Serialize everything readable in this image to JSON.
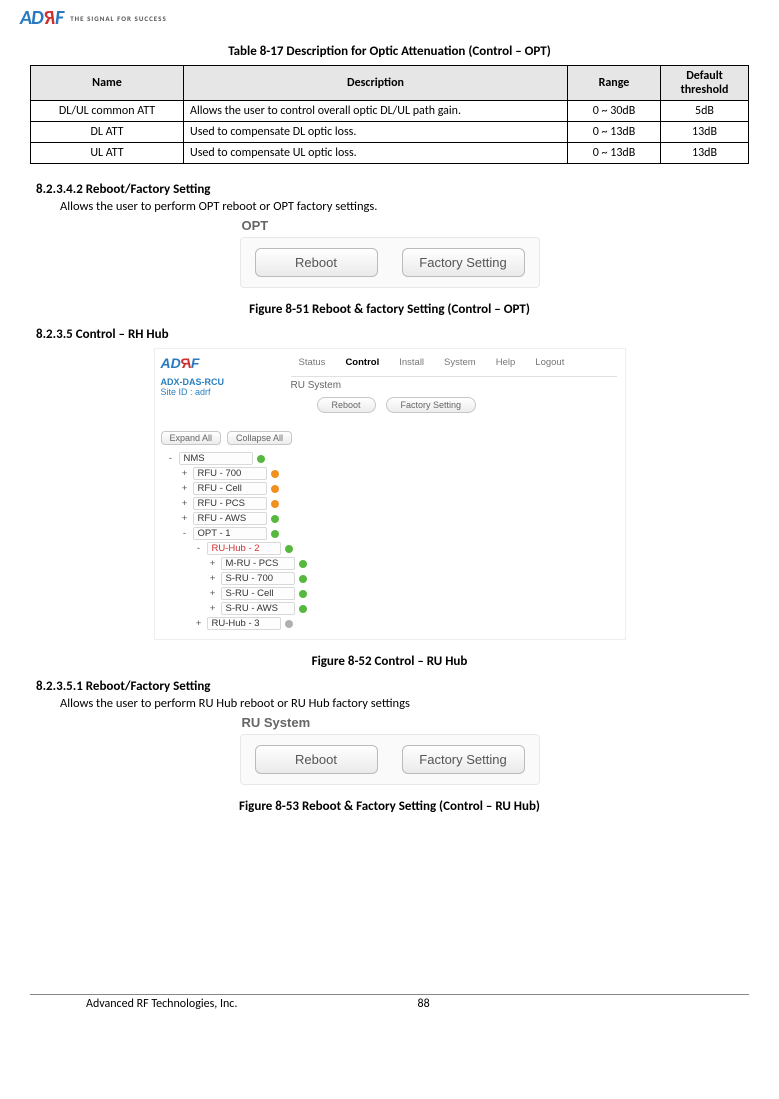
{
  "logo": {
    "tagline": "THE SIGNAL FOR SUCCESS"
  },
  "table817": {
    "caption": "Table 8-17    Description for Optic Attenuation (Control – OPT)",
    "headers": [
      "Name",
      "Description",
      "Range",
      "Default threshold"
    ],
    "rows": [
      [
        "DL/UL common ATT",
        "Allows the user to control overall optic DL/UL path gain.",
        "0 ~ 30dB",
        "5dB"
      ],
      [
        "DL ATT",
        "Used to compensate DL optic loss.",
        "0 ~ 13dB",
        "13dB"
      ],
      [
        "UL ATT",
        "Used to compensate UL optic loss.",
        "0 ~ 13dB",
        "13dB"
      ]
    ]
  },
  "sec823_4_2": {
    "num": "8.2.3.4.2    Reboot/Factory Setting",
    "body": "Allows the user to perform OPT reboot or OPT factory settings.",
    "panel_label": "OPT",
    "btn_reboot": "Reboot",
    "btn_factory": "Factory Setting"
  },
  "fig851": "Figure 8-51    Reboot & factory Setting (Control – OPT)",
  "sec8235": {
    "num": "8.2.3.5    Control – RH Hub"
  },
  "fig52ui": {
    "left": {
      "line1": "ADX-DAS-RCU",
      "line2": "Site ID : adrf"
    },
    "tabs": [
      "Status",
      "Control",
      "Install",
      "System",
      "Help",
      "Logout"
    ],
    "active_tab_index": 1,
    "ru_label": "RU System",
    "btn_reboot": "Reboot",
    "btn_factory": "Factory Setting",
    "expand": "Expand All",
    "collapse": "Collapse All",
    "tree": [
      {
        "toggle": "-",
        "label": "NMS",
        "dot": "green",
        "children": [
          {
            "toggle": "+",
            "label": "RFU - 700",
            "dot": "orange"
          },
          {
            "toggle": "+",
            "label": "RFU - Cell",
            "dot": "orange"
          },
          {
            "toggle": "+",
            "label": "RFU - PCS",
            "dot": "orange"
          },
          {
            "toggle": "+",
            "label": "RFU - AWS",
            "dot": "green"
          },
          {
            "toggle": "-",
            "label": "OPT - 1",
            "dot": "green",
            "children": [
              {
                "toggle": "-",
                "label": "RU-Hub - 2",
                "dot": "green",
                "sel": true,
                "children": [
                  {
                    "toggle": "+",
                    "label": "M-RU - PCS",
                    "dot": "green"
                  },
                  {
                    "toggle": "+",
                    "label": "S-RU - 700",
                    "dot": "green"
                  },
                  {
                    "toggle": "+",
                    "label": "S-RU - Cell",
                    "dot": "green"
                  },
                  {
                    "toggle": "+",
                    "label": "S-RU - AWS",
                    "dot": "green"
                  }
                ]
              },
              {
                "toggle": "+",
                "label": "RU-Hub - 3",
                "dot": "gray"
              }
            ]
          }
        ]
      }
    ]
  },
  "fig852": "Figure 8-52    Control – RU Hub",
  "sec823_5_1": {
    "num": "8.2.3.5.1    Reboot/Factory Setting",
    "body": "Allows the user to perform RU Hub reboot or RU Hub factory settings",
    "panel_label": "RU System",
    "btn_reboot": "Reboot",
    "btn_factory": "Factory Setting"
  },
  "fig853": "Figure 8-53    Reboot & Factory Setting (Control – RU Hub)",
  "footer": {
    "left": "Advanced RF Technologies, Inc.",
    "page": "88"
  }
}
